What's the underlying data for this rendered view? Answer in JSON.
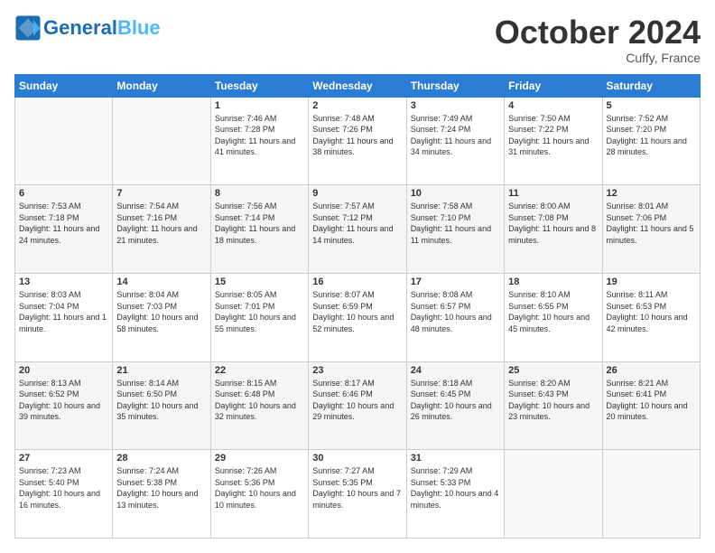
{
  "logo": {
    "general": "General",
    "blue": "Blue"
  },
  "header": {
    "month": "October 2024",
    "location": "Cuffy, France"
  },
  "days_of_week": [
    "Sunday",
    "Monday",
    "Tuesday",
    "Wednesday",
    "Thursday",
    "Friday",
    "Saturday"
  ],
  "weeks": [
    [
      {
        "day": "",
        "sunrise": "",
        "sunset": "",
        "daylight": "",
        "empty": true
      },
      {
        "day": "",
        "sunrise": "",
        "sunset": "",
        "daylight": "",
        "empty": true
      },
      {
        "day": "1",
        "sunrise": "Sunrise: 7:46 AM",
        "sunset": "Sunset: 7:28 PM",
        "daylight": "Daylight: 11 hours and 41 minutes.",
        "empty": false
      },
      {
        "day": "2",
        "sunrise": "Sunrise: 7:48 AM",
        "sunset": "Sunset: 7:26 PM",
        "daylight": "Daylight: 11 hours and 38 minutes.",
        "empty": false
      },
      {
        "day": "3",
        "sunrise": "Sunrise: 7:49 AM",
        "sunset": "Sunset: 7:24 PM",
        "daylight": "Daylight: 11 hours and 34 minutes.",
        "empty": false
      },
      {
        "day": "4",
        "sunrise": "Sunrise: 7:50 AM",
        "sunset": "Sunset: 7:22 PM",
        "daylight": "Daylight: 11 hours and 31 minutes.",
        "empty": false
      },
      {
        "day": "5",
        "sunrise": "Sunrise: 7:52 AM",
        "sunset": "Sunset: 7:20 PM",
        "daylight": "Daylight: 11 hours and 28 minutes.",
        "empty": false
      }
    ],
    [
      {
        "day": "6",
        "sunrise": "Sunrise: 7:53 AM",
        "sunset": "Sunset: 7:18 PM",
        "daylight": "Daylight: 11 hours and 24 minutes.",
        "empty": false
      },
      {
        "day": "7",
        "sunrise": "Sunrise: 7:54 AM",
        "sunset": "Sunset: 7:16 PM",
        "daylight": "Daylight: 11 hours and 21 minutes.",
        "empty": false
      },
      {
        "day": "8",
        "sunrise": "Sunrise: 7:56 AM",
        "sunset": "Sunset: 7:14 PM",
        "daylight": "Daylight: 11 hours and 18 minutes.",
        "empty": false
      },
      {
        "day": "9",
        "sunrise": "Sunrise: 7:57 AM",
        "sunset": "Sunset: 7:12 PM",
        "daylight": "Daylight: 11 hours and 14 minutes.",
        "empty": false
      },
      {
        "day": "10",
        "sunrise": "Sunrise: 7:58 AM",
        "sunset": "Sunset: 7:10 PM",
        "daylight": "Daylight: 11 hours and 11 minutes.",
        "empty": false
      },
      {
        "day": "11",
        "sunrise": "Sunrise: 8:00 AM",
        "sunset": "Sunset: 7:08 PM",
        "daylight": "Daylight: 11 hours and 8 minutes.",
        "empty": false
      },
      {
        "day": "12",
        "sunrise": "Sunrise: 8:01 AM",
        "sunset": "Sunset: 7:06 PM",
        "daylight": "Daylight: 11 hours and 5 minutes.",
        "empty": false
      }
    ],
    [
      {
        "day": "13",
        "sunrise": "Sunrise: 8:03 AM",
        "sunset": "Sunset: 7:04 PM",
        "daylight": "Daylight: 11 hours and 1 minute.",
        "empty": false
      },
      {
        "day": "14",
        "sunrise": "Sunrise: 8:04 AM",
        "sunset": "Sunset: 7:03 PM",
        "daylight": "Daylight: 10 hours and 58 minutes.",
        "empty": false
      },
      {
        "day": "15",
        "sunrise": "Sunrise: 8:05 AM",
        "sunset": "Sunset: 7:01 PM",
        "daylight": "Daylight: 10 hours and 55 minutes.",
        "empty": false
      },
      {
        "day": "16",
        "sunrise": "Sunrise: 8:07 AM",
        "sunset": "Sunset: 6:59 PM",
        "daylight": "Daylight: 10 hours and 52 minutes.",
        "empty": false
      },
      {
        "day": "17",
        "sunrise": "Sunrise: 8:08 AM",
        "sunset": "Sunset: 6:57 PM",
        "daylight": "Daylight: 10 hours and 48 minutes.",
        "empty": false
      },
      {
        "day": "18",
        "sunrise": "Sunrise: 8:10 AM",
        "sunset": "Sunset: 6:55 PM",
        "daylight": "Daylight: 10 hours and 45 minutes.",
        "empty": false
      },
      {
        "day": "19",
        "sunrise": "Sunrise: 8:11 AM",
        "sunset": "Sunset: 6:53 PM",
        "daylight": "Daylight: 10 hours and 42 minutes.",
        "empty": false
      }
    ],
    [
      {
        "day": "20",
        "sunrise": "Sunrise: 8:13 AM",
        "sunset": "Sunset: 6:52 PM",
        "daylight": "Daylight: 10 hours and 39 minutes.",
        "empty": false
      },
      {
        "day": "21",
        "sunrise": "Sunrise: 8:14 AM",
        "sunset": "Sunset: 6:50 PM",
        "daylight": "Daylight: 10 hours and 35 minutes.",
        "empty": false
      },
      {
        "day": "22",
        "sunrise": "Sunrise: 8:15 AM",
        "sunset": "Sunset: 6:48 PM",
        "daylight": "Daylight: 10 hours and 32 minutes.",
        "empty": false
      },
      {
        "day": "23",
        "sunrise": "Sunrise: 8:17 AM",
        "sunset": "Sunset: 6:46 PM",
        "daylight": "Daylight: 10 hours and 29 minutes.",
        "empty": false
      },
      {
        "day": "24",
        "sunrise": "Sunrise: 8:18 AM",
        "sunset": "Sunset: 6:45 PM",
        "daylight": "Daylight: 10 hours and 26 minutes.",
        "empty": false
      },
      {
        "day": "25",
        "sunrise": "Sunrise: 8:20 AM",
        "sunset": "Sunset: 6:43 PM",
        "daylight": "Daylight: 10 hours and 23 minutes.",
        "empty": false
      },
      {
        "day": "26",
        "sunrise": "Sunrise: 8:21 AM",
        "sunset": "Sunset: 6:41 PM",
        "daylight": "Daylight: 10 hours and 20 minutes.",
        "empty": false
      }
    ],
    [
      {
        "day": "27",
        "sunrise": "Sunrise: 7:23 AM",
        "sunset": "Sunset: 5:40 PM",
        "daylight": "Daylight: 10 hours and 16 minutes.",
        "empty": false
      },
      {
        "day": "28",
        "sunrise": "Sunrise: 7:24 AM",
        "sunset": "Sunset: 5:38 PM",
        "daylight": "Daylight: 10 hours and 13 minutes.",
        "empty": false
      },
      {
        "day": "29",
        "sunrise": "Sunrise: 7:26 AM",
        "sunset": "Sunset: 5:36 PM",
        "daylight": "Daylight: 10 hours and 10 minutes.",
        "empty": false
      },
      {
        "day": "30",
        "sunrise": "Sunrise: 7:27 AM",
        "sunset": "Sunset: 5:35 PM",
        "daylight": "Daylight: 10 hours and 7 minutes.",
        "empty": false
      },
      {
        "day": "31",
        "sunrise": "Sunrise: 7:29 AM",
        "sunset": "Sunset: 5:33 PM",
        "daylight": "Daylight: 10 hours and 4 minutes.",
        "empty": false
      },
      {
        "day": "",
        "sunrise": "",
        "sunset": "",
        "daylight": "",
        "empty": true
      },
      {
        "day": "",
        "sunrise": "",
        "sunset": "",
        "daylight": "",
        "empty": true
      }
    ]
  ]
}
